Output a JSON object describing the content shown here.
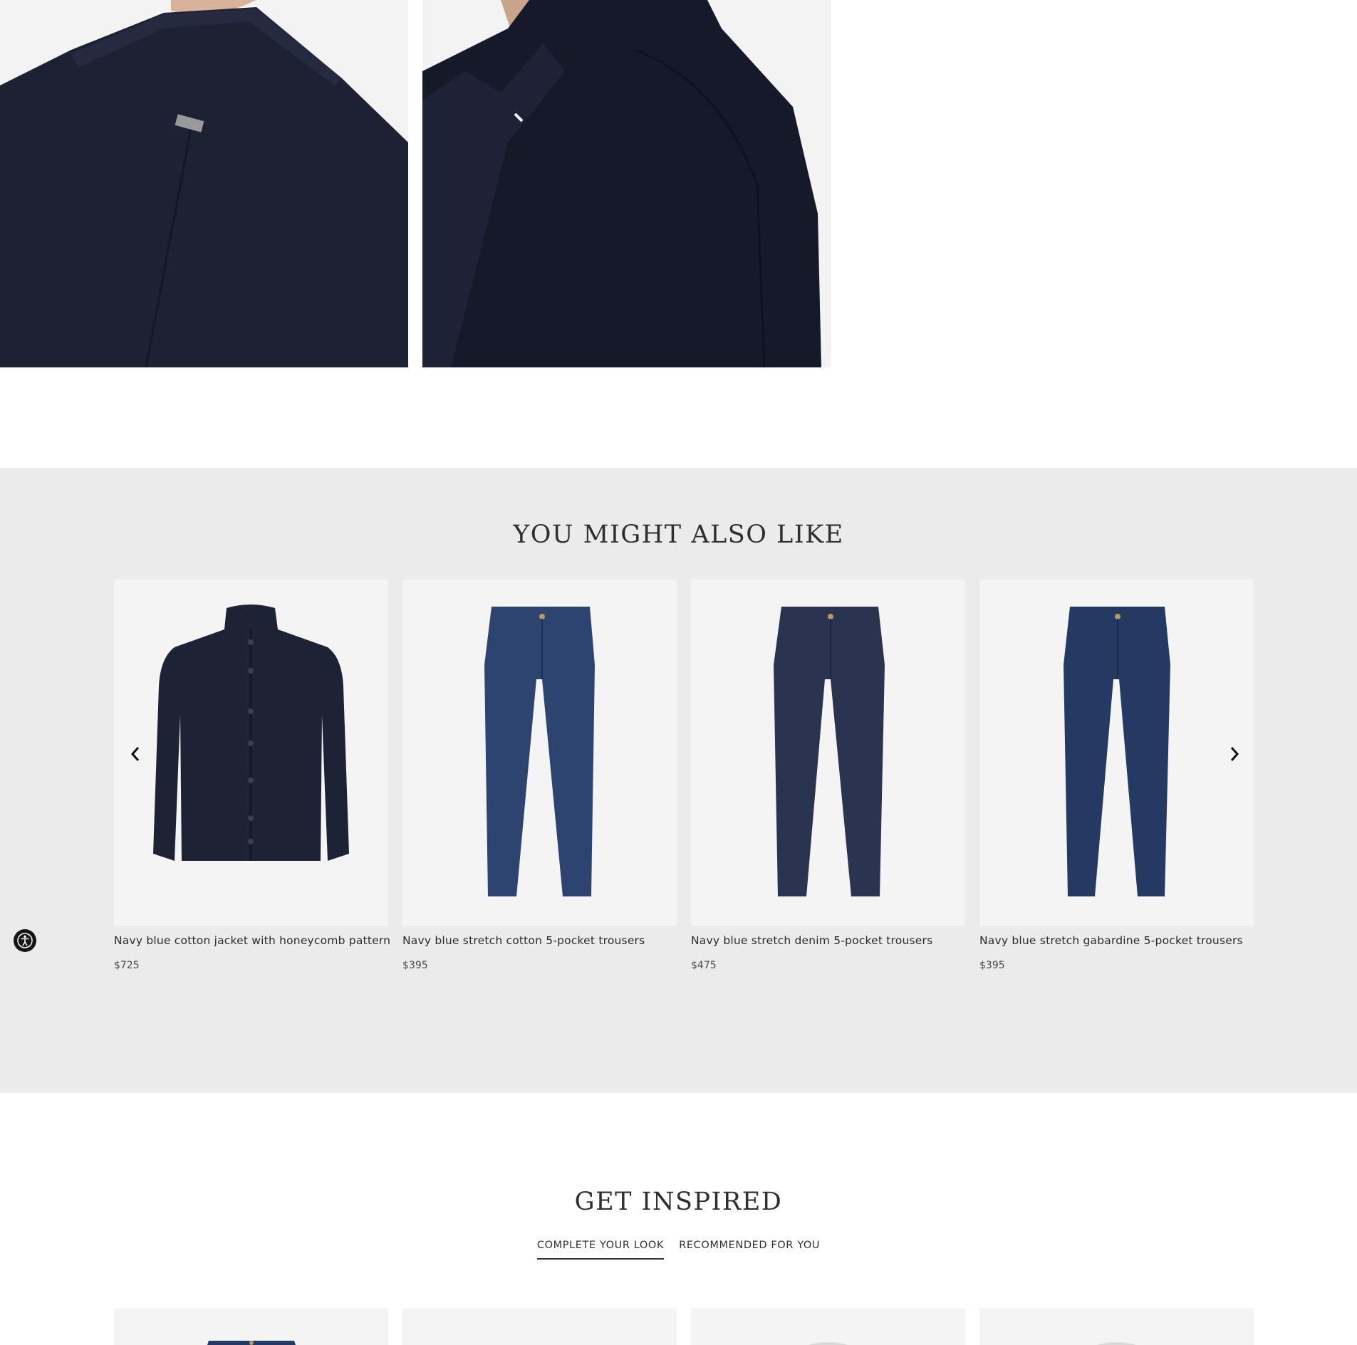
{
  "gallery": {
    "images": [
      {
        "alt": "jacket-back-detail"
      },
      {
        "alt": "jacket-side-detail"
      }
    ]
  },
  "recommendations": {
    "title": "YOU MIGHT ALSO LIKE",
    "products": [
      {
        "name": "Navy blue cotton jacket with honeycomb pattern",
        "price": "$725",
        "image": "knit-jacket",
        "color": "#1d2235"
      },
      {
        "name": "Navy blue stretch cotton 5-pocket trousers",
        "price": "$395",
        "image": "trousers",
        "color": "#2d4470"
      },
      {
        "name": "Navy blue stretch denim 5-pocket trousers",
        "price": "$475",
        "image": "trousers",
        "color": "#2a3350"
      },
      {
        "name": "Navy blue stretch gabardine 5-pocket trousers",
        "price": "$395",
        "image": "trousers",
        "color": "#243a63"
      }
    ],
    "prev_icon": "chevron-left-icon",
    "next_icon": "chevron-right-icon"
  },
  "inspired": {
    "title": "GET INSPIRED",
    "tabs": [
      {
        "label": "COMPLETE YOUR LOOK",
        "active": true
      },
      {
        "label": "RECOMMENDED FOR YOU",
        "active": false
      }
    ]
  },
  "accessibility": {
    "icon": "accessibility-icon"
  }
}
